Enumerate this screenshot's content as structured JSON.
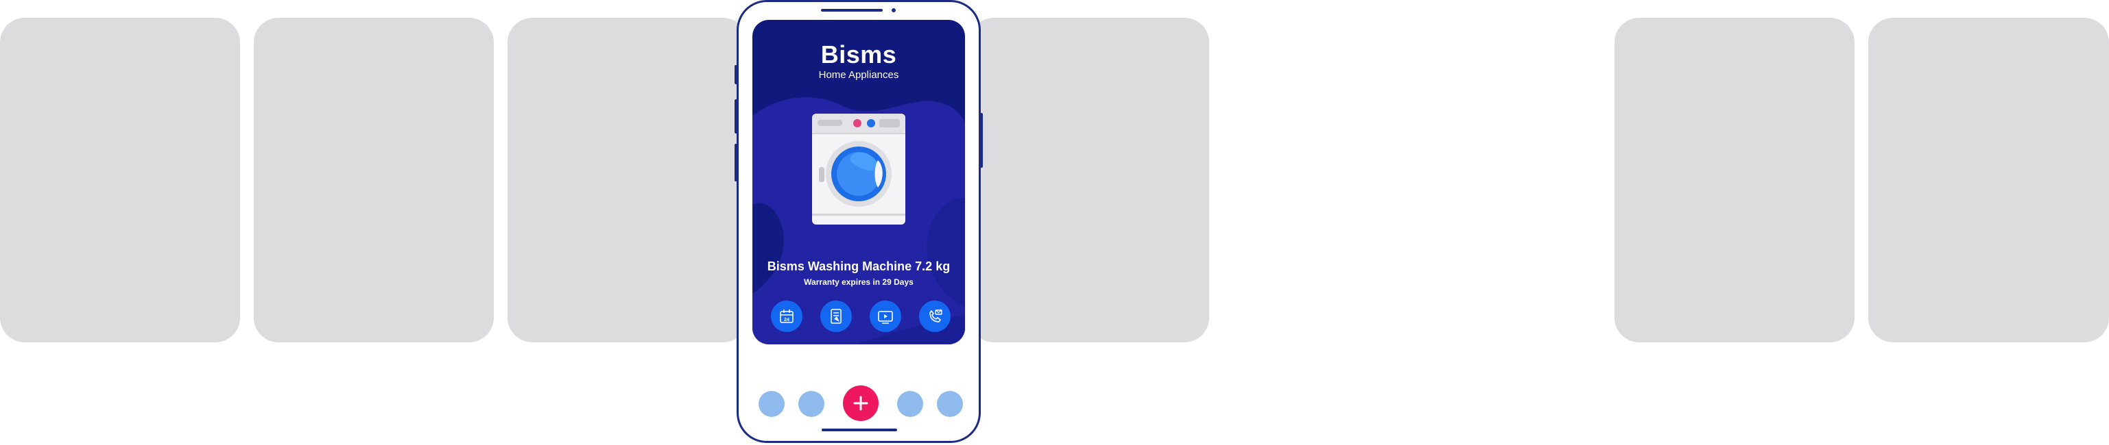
{
  "app": {
    "brand": "Bisms",
    "subtitle": "Home Appliances"
  },
  "product": {
    "name": "Bisms Washing Machine 7.2 kg",
    "warranty": "Warranty expires in 29 Days"
  },
  "actions": [
    {
      "icon": "calendar-icon"
    },
    {
      "icon": "manual-document-icon"
    },
    {
      "icon": "video-tutorial-icon"
    },
    {
      "icon": "support-call-icon"
    }
  ],
  "dock": {
    "items": [
      "dock-item",
      "dock-item",
      "add-button",
      "dock-item",
      "dock-item"
    ]
  },
  "colors": {
    "card_bg": "#0f1a7c",
    "card_accent": "#2224a3",
    "action_blue": "#1467f0",
    "fab_pink": "#ee1860",
    "dock_dot": "#8ebaee",
    "ghost_card": "#dcdcde",
    "phone_frame": "#1a2a86"
  }
}
